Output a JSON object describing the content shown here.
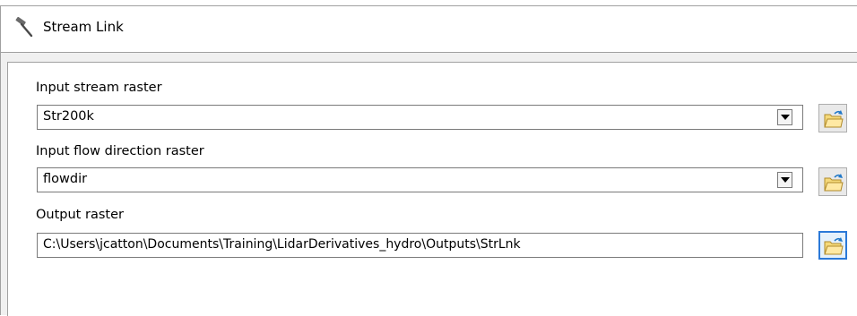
{
  "window": {
    "title": "Stream Link",
    "title_icon": "hammer-icon"
  },
  "fields": {
    "input_stream_raster": {
      "label": "Input stream raster",
      "value": "Str200k"
    },
    "input_flow_direction_raster": {
      "label": "Input flow direction raster",
      "value": "flowdir"
    },
    "output_raster": {
      "label": "Output raster",
      "value": "C:\\Users\\jcatton\\Documents\\Training\\LidarDerivatives_hydro\\Outputs\\StrLnk"
    }
  },
  "icons": {
    "dropdown": "dropdown-arrow-icon",
    "browse": "open-folder-icon"
  },
  "colors": {
    "folder_fill": "#f5d97a",
    "folder_stroke": "#b08a2b",
    "arrow": "#1f77c8",
    "focus_border": "#2b79d8"
  }
}
